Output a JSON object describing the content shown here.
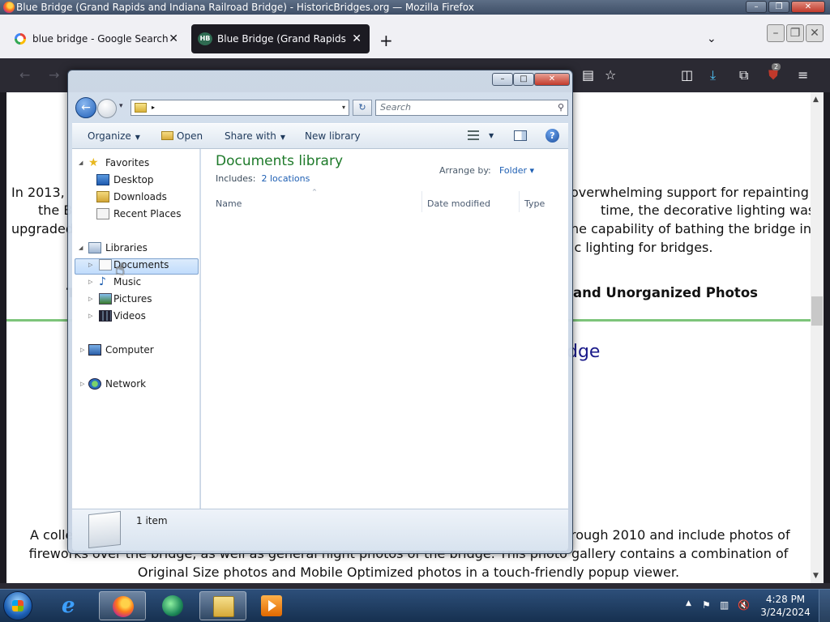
{
  "firefox": {
    "window_title": "Blue Bridge (Grand Rapids and Indiana Railroad Bridge) - HistoricBridges.org — Mozilla Firefox",
    "tabs": [
      {
        "label": "blue bridge - Google Search",
        "close": "✕"
      },
      {
        "label": "Blue Bridge (Grand Rapids and Indiana Railroad Bridge) - HistoricBridges.org",
        "close": "✕",
        "favicon_text": "HB"
      }
    ],
    "new_tab": "+",
    "tab_list": "⌄",
    "tab_window_buttons": [
      "–",
      "❐",
      "✕"
    ],
    "title_window_buttons": [
      "–",
      "❐",
      "✕"
    ],
    "toolbar": {
      "back": "←",
      "forward": "→",
      "reader": "▤",
      "bookmark": "☆",
      "pocket": "◫",
      "downloads": "⤓",
      "extensions": "⧉",
      "ublock_badge": "2",
      "menu": "≡"
    }
  },
  "page": {
    "left_lines": [
      "In 2013,",
      "the B",
      "upgraded"
    ],
    "right_lines": [
      "overwhelming support for repainting",
      "time, the decorative lighting was",
      "he capability of bathing the bridge in",
      "ic lighting for bridges."
    ],
    "left_T": "T",
    "subheading_right": "and Unorganized Photos",
    "heading_right": "dge",
    "bottom_left": "A colle",
    "bottom_right": "rough 2010 and include photos of",
    "bottom_line2": "fireworks over the bridge, as well as general night photos of the bridge. This photo gallery contains a combination of",
    "bottom_line3": "Original Size photos and Mobile Optimized photos in a touch-friendly popup viewer."
  },
  "explorer": {
    "window_buttons": [
      "–",
      "□",
      "✕"
    ],
    "address_caret": "▸",
    "address_dropdown": "▾",
    "history_dropdown": "▾",
    "refresh": "↻",
    "search_placeholder": "Search",
    "search_icon": "⚲",
    "toolbar": {
      "organize": "Organize",
      "open": "Open",
      "share_with": "Share with",
      "new_library": "New library",
      "help": "?"
    },
    "nav": {
      "favorites": "Favorites",
      "desktop": "Desktop",
      "downloads": "Downloads",
      "recent_places": "Recent Places",
      "libraries": "Libraries",
      "documents": "Documents",
      "music": "Music",
      "pictures": "Pictures",
      "videos": "Videos",
      "computer": "Computer",
      "network": "Network"
    },
    "library": {
      "title": "Documents library",
      "includes_label": "Includes:",
      "includes_link": "2 locations",
      "arrange_label": "Arrange by:",
      "arrange_value": "Folder ▾",
      "sort_caret": "^"
    },
    "columns": [
      "Name",
      "Date modified",
      "Type"
    ],
    "status": "1 item"
  },
  "taskbar": {
    "time": "4:28 PM",
    "date": "3/24/2024",
    "tray_expand": "▲",
    "tray_flag": "⚑",
    "tray_network": "▥",
    "tray_volume": "🔇"
  }
}
